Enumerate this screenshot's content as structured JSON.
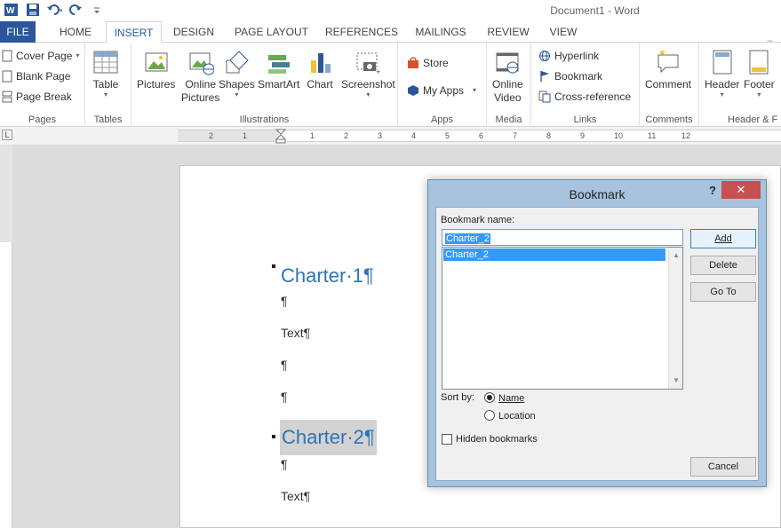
{
  "window": {
    "title": "Document1 - Word"
  },
  "quick_access": [
    "word-app-icon",
    "save-icon",
    "undo-icon",
    "redo-icon",
    "customize-icon"
  ],
  "tabs": [
    {
      "label": "FILE"
    },
    {
      "label": "HOME"
    },
    {
      "label": "INSERT"
    },
    {
      "label": "DESIGN"
    },
    {
      "label": "PAGE LAYOUT"
    },
    {
      "label": "REFERENCES"
    },
    {
      "label": "MAILINGS"
    },
    {
      "label": "REVIEW"
    },
    {
      "label": "VIEW"
    }
  ],
  "ribbon": {
    "pages": {
      "label": "Pages",
      "cover_page": "Cover Page",
      "blank_page": "Blank Page",
      "page_break": "Page Break"
    },
    "tables": {
      "label": "Tables",
      "table": "Table"
    },
    "illustrations": {
      "label": "Illustrations",
      "pictures": "Pictures",
      "online": "Online",
      "pictures2": "Pictures",
      "shapes": "Shapes",
      "smartart": "SmartArt",
      "chart": "Chart",
      "screenshot": "Screenshot"
    },
    "apps": {
      "label": "Apps",
      "store": "Store",
      "my_apps": "My Apps"
    },
    "media": {
      "label": "Media",
      "online": "Online",
      "video": "Video"
    },
    "links": {
      "label": "Links",
      "hyperlink": "Hyperlink",
      "bookmark": "Bookmark",
      "cross_reference": "Cross-reference"
    },
    "comments": {
      "label": "Comments",
      "comment": "Comment"
    },
    "header_footer": {
      "label": "Header & F",
      "header": "Header",
      "footer": "Footer"
    }
  },
  "ruler": {
    "left_numbers": [
      "2",
      "1"
    ],
    "right_numbers": [
      "1",
      "2",
      "3",
      "4",
      "5",
      "6",
      "7",
      "8",
      "9",
      "10",
      "11",
      "12"
    ]
  },
  "document": {
    "paragraphs": [
      {
        "text": "Charter·1¶",
        "style": "heading"
      },
      {
        "text": "¶"
      },
      {
        "text": "Text¶"
      },
      {
        "text": "¶"
      },
      {
        "text": "¶"
      },
      {
        "text": "Charter·2¶",
        "style": "heading-highlighted"
      },
      {
        "text": "¶"
      },
      {
        "text": "Text¶"
      }
    ]
  },
  "dialog": {
    "title": "Bookmark",
    "help": "?",
    "close": "✕",
    "name_label": "Bookmark name:",
    "name_value": "Charter_2",
    "list_items": [
      "Charter_2"
    ],
    "add": "Add",
    "delete": "Delete",
    "goto": "Go To",
    "sort_by": "Sort by:",
    "sort_name": "Name",
    "sort_location": "Location",
    "hidden": "Hidden bookmarks",
    "cancel": "Cancel"
  },
  "colors": {
    "accent": "#2b579a",
    "heading": "#2e74b5",
    "selection": "#3399ff",
    "close": "#c75050"
  }
}
